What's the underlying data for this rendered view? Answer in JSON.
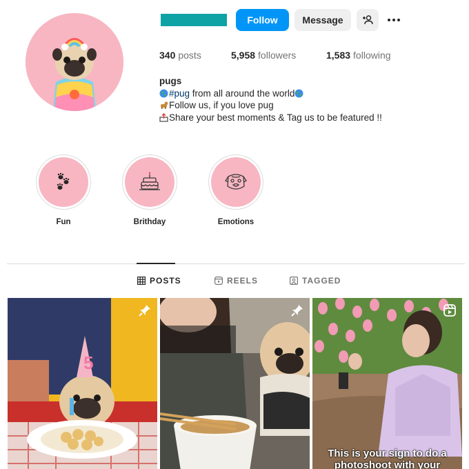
{
  "profile": {
    "follow_label": "Follow",
    "message_label": "Message",
    "icons": {
      "suggest": "person-plus-icon",
      "more": "more-options-icon"
    }
  },
  "stats": {
    "posts_count": "340",
    "posts_label": "posts",
    "followers_count": "5,958",
    "followers_label": "followers",
    "following_count": "1,583",
    "following_label": "following"
  },
  "bio": {
    "name": "pugs",
    "line1_tag": "#pug",
    "line1_text": " from all around the world",
    "line2_text": "Follow us, if you love pug",
    "line3_text": "Share your best moments & Tag us to be featured !!"
  },
  "highlights": [
    {
      "label": "Fun",
      "icon": "paw-prints-icon"
    },
    {
      "label": "Brithday",
      "icon": "birthday-cake-icon"
    },
    {
      "label": "Emotions",
      "icon": "pug-face-icon"
    }
  ],
  "tabs": [
    {
      "label": "POSTS",
      "icon": "grid-icon",
      "active": true
    },
    {
      "label": "REELS",
      "icon": "reels-icon",
      "active": false
    },
    {
      "label": "TAGGED",
      "icon": "tagged-icon",
      "active": false
    }
  ],
  "posts": [
    {
      "badge": "pin-icon",
      "caption": ""
    },
    {
      "badge": "pin-icon",
      "caption": ""
    },
    {
      "badge": "reel-icon",
      "caption": "This is your sign to do a photoshoot with your"
    }
  ],
  "colors": {
    "accent": "#0095f6",
    "username_redacted": "#10a3a6",
    "highlight_bg": "#f7b6c2",
    "link": "#00376b"
  }
}
